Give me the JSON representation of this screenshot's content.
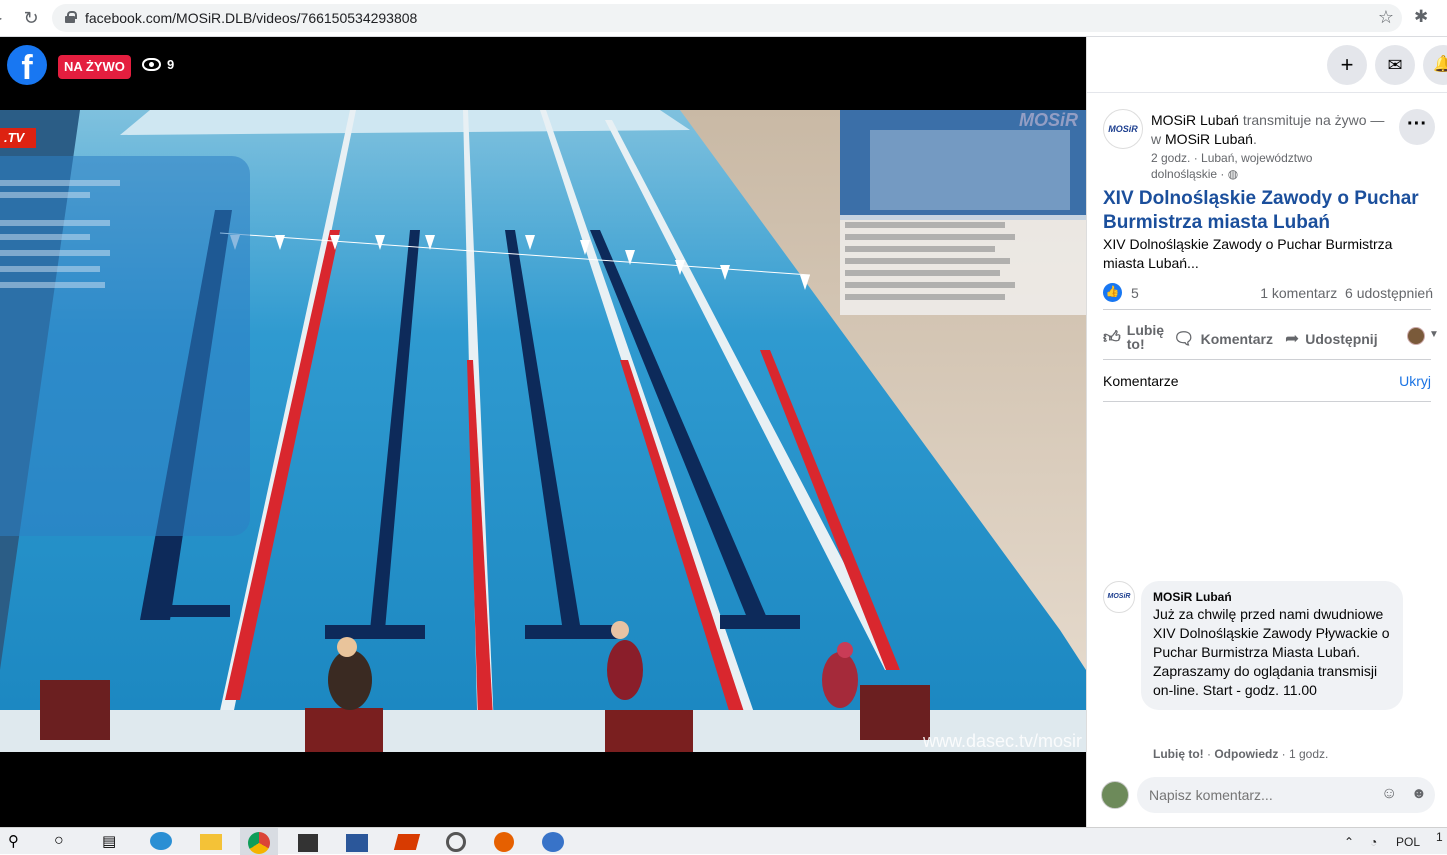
{
  "browser": {
    "url": "facebook.com/MOSiR.DLB/videos/766150534293808"
  },
  "player": {
    "live_label": "NA ŻYWO",
    "viewer_count": "9",
    "tv_logo": ".TV",
    "brand_logo": "MOSiR",
    "watermark": "www.dasec.tv/mosir"
  },
  "post": {
    "author": "MOSiR Lubań",
    "action_text": "transmituje na żywo — w",
    "location_name": "MOSiR Lubań",
    "meta": "2 godz. · Lubań, województwo dolnośląskie · ",
    "avatar_text": "MOSiR",
    "title": "XIV Dolnośląskie Zawody o Puchar Burmistrza miasta Lubań",
    "description": "XIV Dolnośląskie Zawody o Puchar Burmistrza miasta Lubań...",
    "like_count": "5",
    "comment_count": "1 komentarz",
    "share_count": "6 udostępnień"
  },
  "actions": {
    "like": "Lubię to!",
    "comment": "Komentarz",
    "share": "Udostępnij"
  },
  "comments_section": {
    "header": "Komentarze",
    "hide": "Ukryj",
    "items": [
      {
        "author": "MOSiR Lubań",
        "text": "Już za chwilę przed nami dwudniowe XIV Dolnośląskie Zawody Pływackie o Puchar Burmistrza Miasta Lubań. Zapraszamy do oglądania transmisji on-line. Start - godz. 11.00",
        "like": "Lubię to!",
        "reply": "Odpowiedz",
        "time": "1 godz."
      }
    ],
    "input_placeholder": "Napisz komentarz..."
  },
  "taskbar": {
    "language": "POL",
    "time_fragment": "1"
  },
  "colors": {
    "fb_blue": "#1877f2",
    "live_red": "#e41e3f",
    "title_blue": "#1b4f9c",
    "link_blue": "#1b74e4"
  }
}
